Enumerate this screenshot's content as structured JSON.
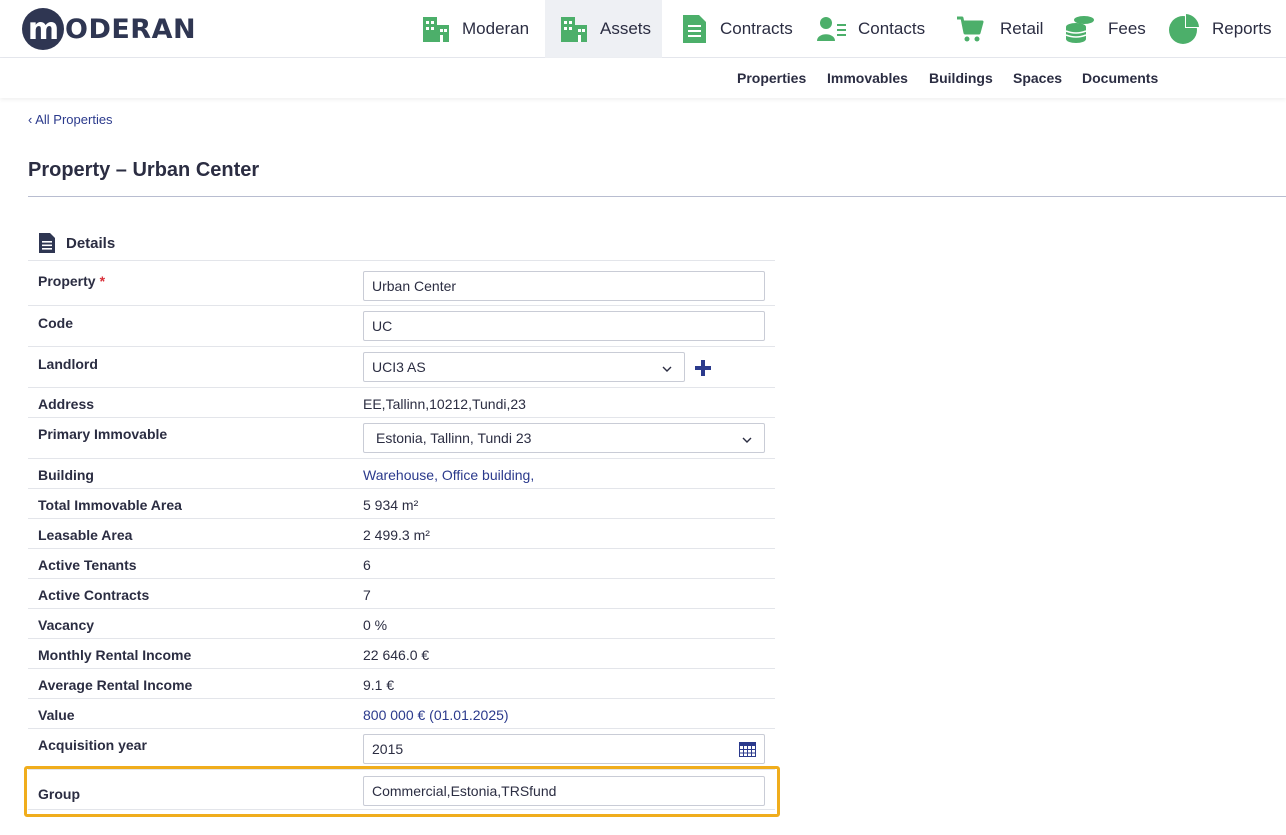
{
  "logo": {
    "mark": "m",
    "text": "ODERAN"
  },
  "nav": [
    {
      "label": "Moderan",
      "icon": "building-icon"
    },
    {
      "label": "Assets",
      "icon": "building-icon"
    },
    {
      "label": "Contracts",
      "icon": "document-icon"
    },
    {
      "label": "Contacts",
      "icon": "contact-card-icon"
    },
    {
      "label": "Retail",
      "icon": "shopping-cart-icon"
    },
    {
      "label": "Fees",
      "icon": "coins-icon"
    },
    {
      "label": "Reports",
      "icon": "pie-chart-icon"
    }
  ],
  "active_nav": "Assets",
  "icon_color": "#4caf6a",
  "subnav": [
    "Properties",
    "Immovables",
    "Buildings",
    "Spaces",
    "Documents"
  ],
  "breadcrumb": "All Properties",
  "page_title": "Property – Urban Center",
  "section_title": "Details",
  "fields": {
    "property": {
      "label": "Property",
      "required_mark": "*",
      "value": "Urban Center"
    },
    "code": {
      "label": "Code",
      "value": "UC"
    },
    "landlord": {
      "label": "Landlord",
      "value": "UCI3 AS"
    },
    "address": {
      "label": "Address",
      "value": "EE,Tallinn,10212,Tundi,23"
    },
    "primary_immovable": {
      "label": "Primary Immovable",
      "value": "Estonia, Tallinn, Tundi 23"
    },
    "building": {
      "label": "Building",
      "value": "Warehouse, Office building,"
    },
    "total_immovable_area": {
      "label": "Total Immovable Area",
      "value": "5 934 m²"
    },
    "leasable_area": {
      "label": "Leasable Area",
      "value": "2 499.3 m²"
    },
    "active_tenants": {
      "label": "Active Tenants",
      "value": "6"
    },
    "active_contracts": {
      "label": "Active Contracts",
      "value": "7"
    },
    "vacancy": {
      "label": "Vacancy",
      "value": "0 %"
    },
    "monthly_rental_income": {
      "label": "Monthly Rental Income",
      "value": "22 646.0 €"
    },
    "average_rental_income": {
      "label": "Average Rental Income",
      "value": "9.1 €"
    },
    "value": {
      "label": "Value",
      "value": "800 000 € (01.01.2025)"
    },
    "acquisition_year": {
      "label": "Acquisition year",
      "value": "2015"
    },
    "group": {
      "label": "Group",
      "value": "Commercial,Estonia,TRSfund"
    }
  },
  "colors": {
    "link": "#2b3a8c",
    "highlight": "#f0ad1c",
    "required": "#d9303a"
  }
}
